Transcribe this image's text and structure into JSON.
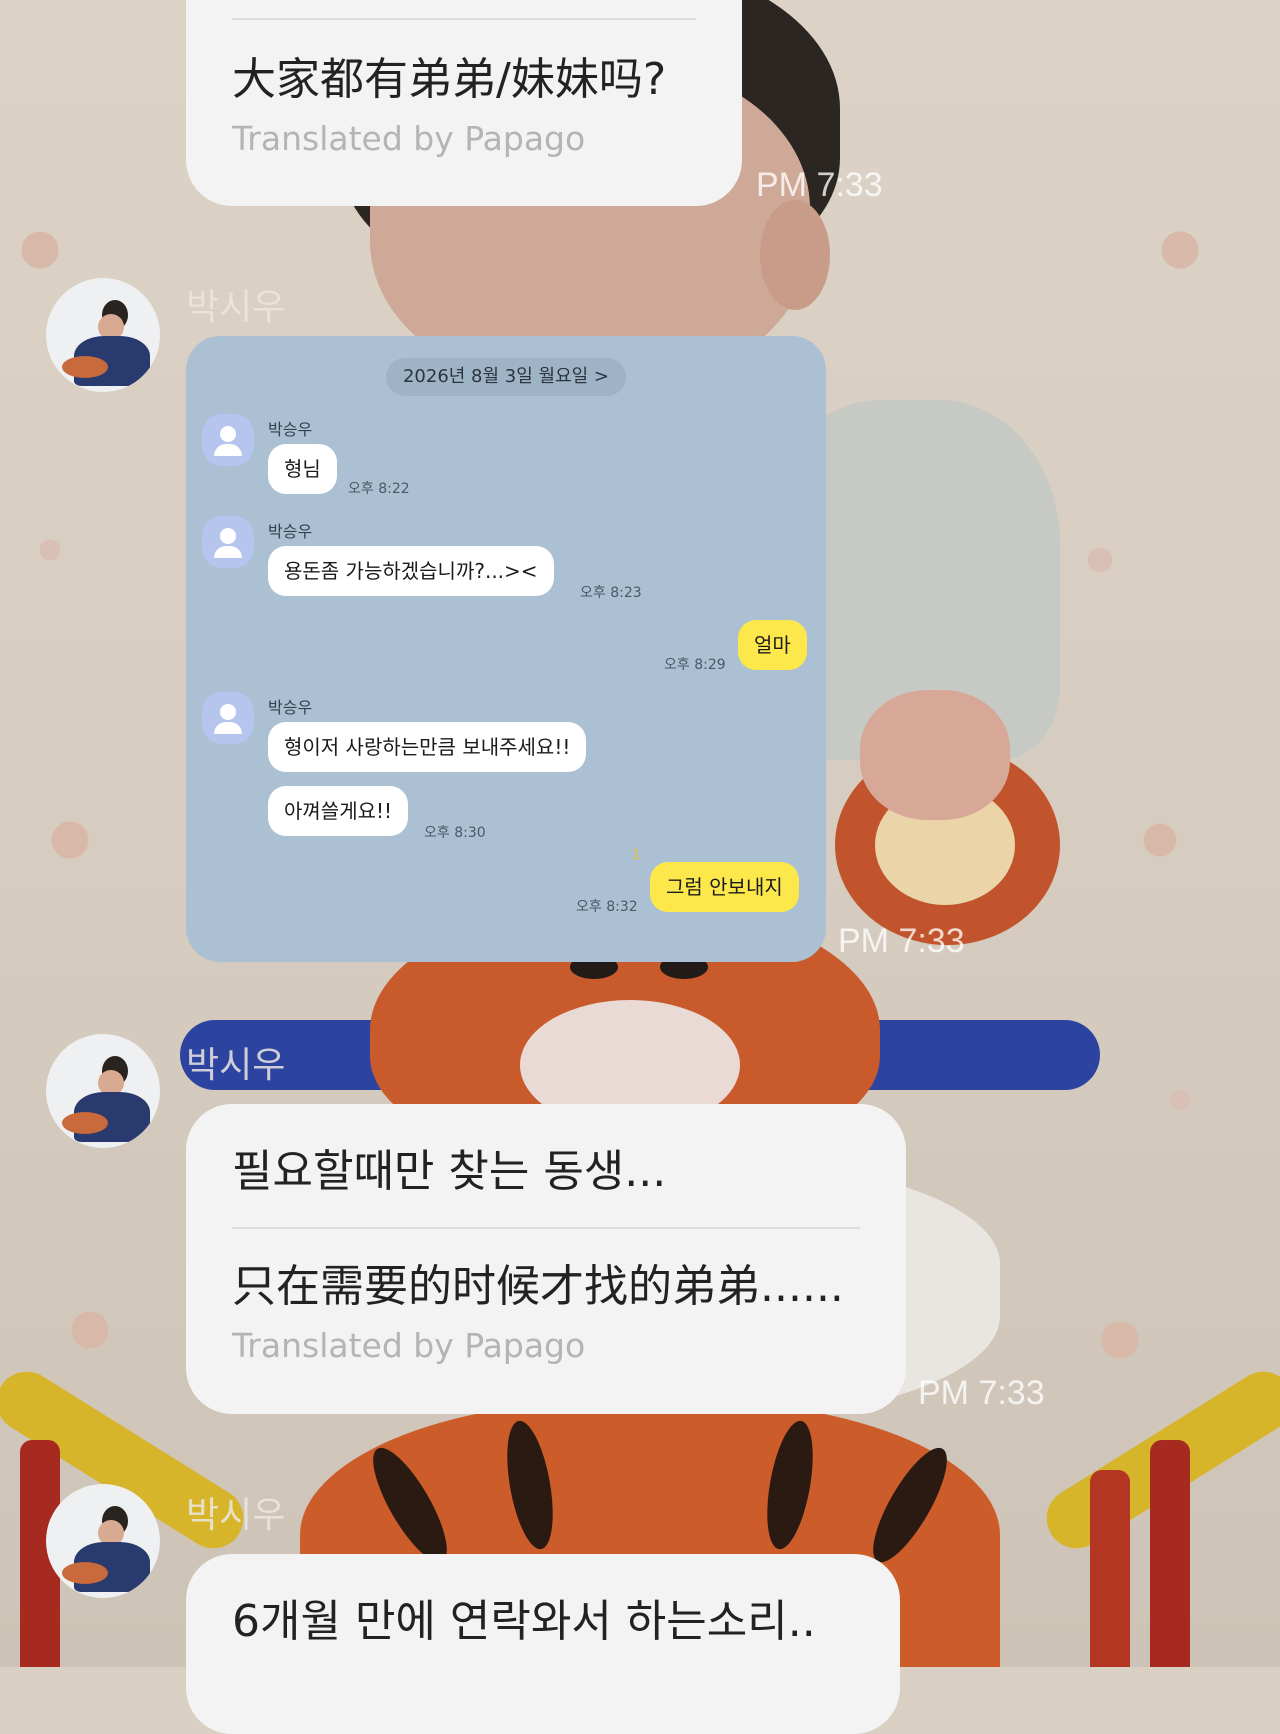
{
  "messages": [
    {
      "original": "",
      "translation": "大家都有弟弟/妹妹吗?",
      "translated_by": "Translated by Papago",
      "time": "PM 7:33"
    },
    {
      "sender": "박시우",
      "time": "PM 7:33",
      "embedded_screenshot": {
        "date": "2026년 8월 3일 월요일 >",
        "messages": [
          {
            "from": "박승우",
            "text": "형님",
            "time": "오후 8:22"
          },
          {
            "from": "박승우",
            "text": "용돈좀 가능하겠습니까?...><",
            "time": "오후 8:23"
          },
          {
            "from": "me",
            "text": "얼마",
            "time": "오후 8:29"
          },
          {
            "from": "박승우",
            "text": "형이저 사랑하는만큼 보내주세요!!",
            "time": ""
          },
          {
            "from": "박승우",
            "text": "아껴쓸게요!!",
            "time": "오후 8:30"
          },
          {
            "from": "me",
            "text": "그럼 안보내지",
            "time": "오후 8:32",
            "unread": "1"
          }
        ]
      }
    },
    {
      "sender": "박시우",
      "original": "필요할때만 찾는 동생...",
      "translation": "只在需要的时候才找的弟弟......",
      "translated_by": "Translated by Papago",
      "time": "PM 7:33"
    },
    {
      "sender": "박시우",
      "original": "6개월 만에 연락와서 하는소리.."
    }
  ]
}
